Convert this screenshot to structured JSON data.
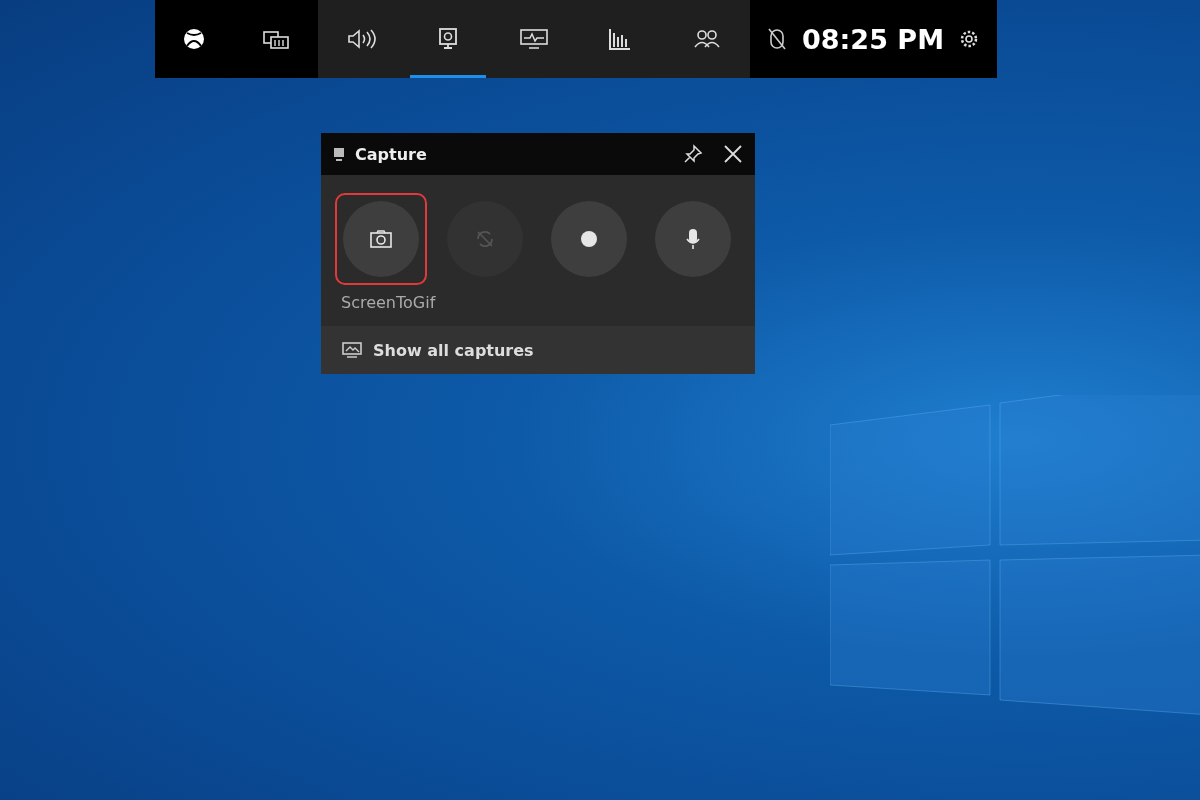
{
  "game_bar": {
    "left_buttons": [
      {
        "kind": "xbox"
      },
      {
        "kind": "widget-menu"
      }
    ],
    "widgets": [
      {
        "kind": "audio",
        "selected": false
      },
      {
        "kind": "capture",
        "selected": true
      },
      {
        "kind": "performance",
        "selected": false
      },
      {
        "kind": "resources",
        "selected": false
      },
      {
        "kind": "social",
        "selected": false
      }
    ],
    "clock": "08:25 PM"
  },
  "capture_widget": {
    "title": "Capture",
    "buttons": [
      {
        "kind": "screenshot",
        "disabled": false,
        "outlined": true
      },
      {
        "kind": "record-last",
        "disabled": true,
        "outlined": false
      },
      {
        "kind": "record",
        "disabled": false,
        "outlined": false
      },
      {
        "kind": "mic",
        "disabled": false,
        "outlined": false
      }
    ],
    "app_name": "ScreenToGif",
    "footer_link": "Show all captures"
  }
}
